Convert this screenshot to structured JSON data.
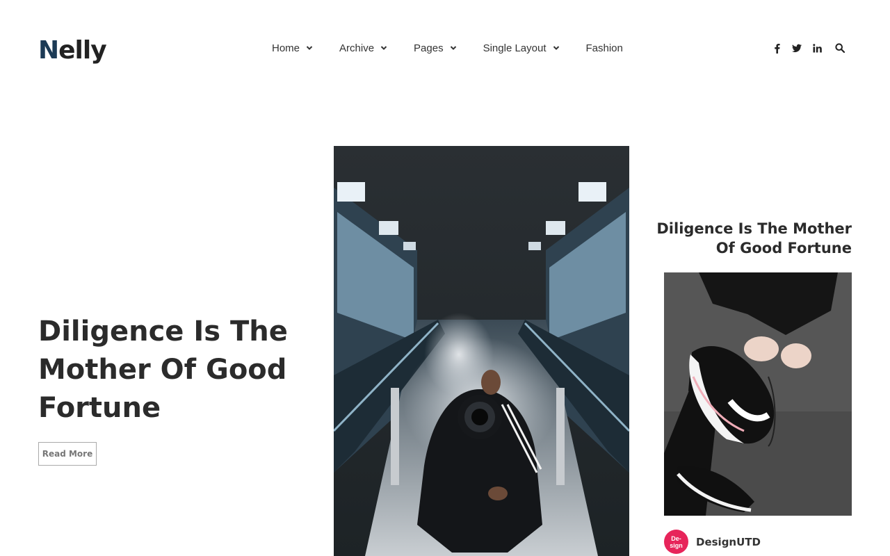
{
  "brand": {
    "initial": "N",
    "rest": "elly"
  },
  "nav": {
    "items": [
      {
        "label": "Home",
        "has_dropdown": true
      },
      {
        "label": "Archive",
        "has_dropdown": true
      },
      {
        "label": "Pages",
        "has_dropdown": true
      },
      {
        "label": "Single Layout",
        "has_dropdown": true
      },
      {
        "label": "Fashion",
        "has_dropdown": false
      }
    ]
  },
  "social_icons": [
    "facebook-icon",
    "twitter-icon",
    "linkedin-icon",
    "search-icon"
  ],
  "hero": {
    "title": "Diligence Is The Mother Of Good Fortune",
    "button_label": "Read More"
  },
  "side_post": {
    "title": "Diligence Is The Mother Of Good Fortune",
    "author": {
      "avatar_text": "De-\nsign",
      "name": "DesignUTD"
    }
  },
  "colors": {
    "logo_accent": "#1c3a55",
    "avatar_bg": "#e7245a",
    "text_dark": "#2b2b2b"
  }
}
